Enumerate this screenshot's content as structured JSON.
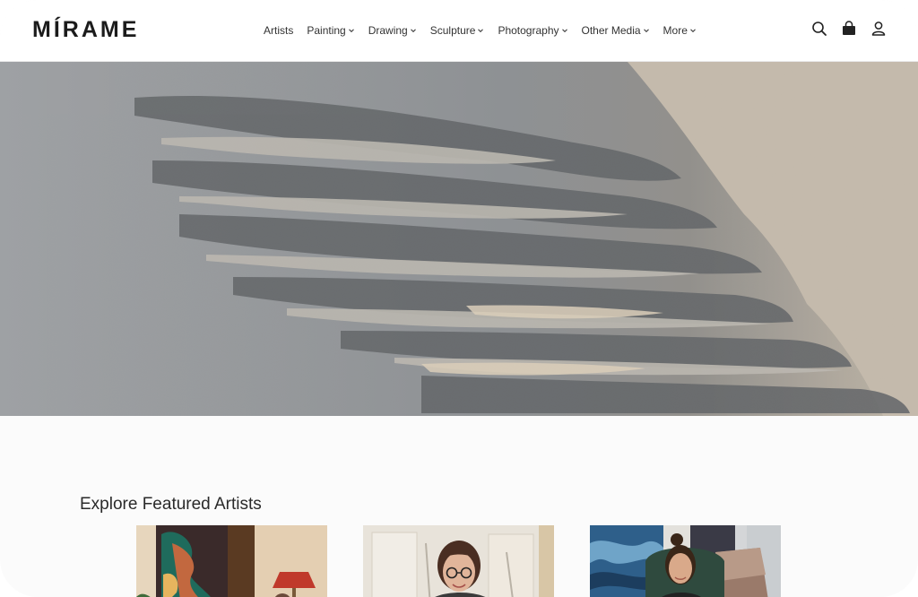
{
  "brand": {
    "name": "MÍRAME"
  },
  "nav": {
    "items": [
      {
        "label": "Artists",
        "has_dropdown": false
      },
      {
        "label": "Painting",
        "has_dropdown": true
      },
      {
        "label": "Drawing",
        "has_dropdown": true
      },
      {
        "label": "Sculpture",
        "has_dropdown": true
      },
      {
        "label": "Photography",
        "has_dropdown": true
      },
      {
        "label": "Other Media",
        "has_dropdown": true
      },
      {
        "label": "More",
        "has_dropdown": true
      }
    ]
  },
  "header_icons": [
    "search-icon",
    "shopping-bag-icon",
    "account-icon"
  ],
  "featured": {
    "title": "Explore Featured Artists",
    "cards": [
      {
        "image": "artist-1-photo"
      },
      {
        "image": "artist-2-photo"
      },
      {
        "image": "artist-3-photo"
      }
    ]
  },
  "colors": {
    "text": "#222222",
    "header_bg": "#ffffff",
    "page_bg": "#fbfbfb"
  }
}
